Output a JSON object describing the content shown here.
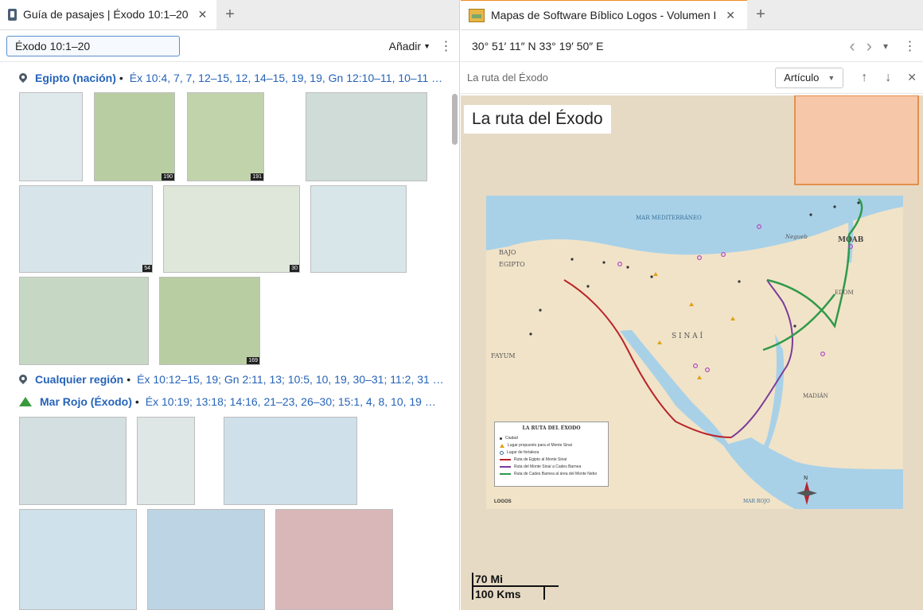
{
  "left": {
    "tab_title": "Guía de pasajes | Éxodo 10:1–20",
    "tab_close": "✕",
    "new_tab": "+",
    "reference_input_value": "Éxodo 10:1–20",
    "add_label": "Añadir",
    "kebab": "⋮",
    "sections": [
      {
        "name": "Egipto (nación)",
        "refs": "Éx 10:4, 7, 7, 12–15, 12, 14–15, 19, 19, Gn 12:10–11, 10–11 …"
      },
      {
        "name": "Cualquier región",
        "refs": "Éx 10:12–15, 19; Gn 2:11, 13; 10:5, 10, 19, 30–31; 11:2, 31 …"
      },
      {
        "name": "Mar Rojo (Éxodo)",
        "refs": "Éx 10:19; 13:18; 14:16, 21–23, 26–30; 15:1, 4, 8, 10, 19 …"
      }
    ],
    "thumb_numbers": [
      "190",
      "191",
      "54",
      "30",
      "169"
    ]
  },
  "right": {
    "tab_title": "Mapas de Software Bíblico Logos - Volumen I",
    "tab_close": "✕",
    "new_tab": "+",
    "coordinates": "30° 51′ 11″ N 33° 19′ 50″ E",
    "nav_back": "‹",
    "nav_forward": "›",
    "nav_menu": "▾",
    "kebab": "⋮",
    "search_text": "La ruta del Éxodo",
    "article_select": "Artículo",
    "arrow_up": "↑",
    "arrow_down": "↓",
    "close": "✕",
    "map_title": "La ruta del Éxodo",
    "scale_mi": "70 Mi",
    "scale_km": "100 Kms",
    "map_labels": {
      "sea": "MAR MEDITERRÁNEO",
      "bajo": "BAJO",
      "egipto": "EGIPTO",
      "fayum": "FAYUM",
      "sinai": "S I N A Í",
      "moab": "MOAB",
      "edom": "EDOM",
      "madian": "MADIÁN",
      "mar_rojo": "MAR ROJO",
      "negueb": "Negueb",
      "north": "N"
    },
    "legend": {
      "title": "LA RUTA DEL ÉXODO",
      "items": [
        "Ciudad",
        "Lugar propuesto para el Monte Sinaí",
        "Lugar de fortaleza",
        "Ruta de Egipto al Monte Sinaí",
        "Ruta del Monte Sinaí a Cades Barnea",
        "Ruta de Cades Barnea al área del Monte Nebo"
      ],
      "brand": "LOGOS",
      "colors": [
        "#b8242a",
        "#7a3c9a",
        "#2f9a4a"
      ]
    }
  }
}
